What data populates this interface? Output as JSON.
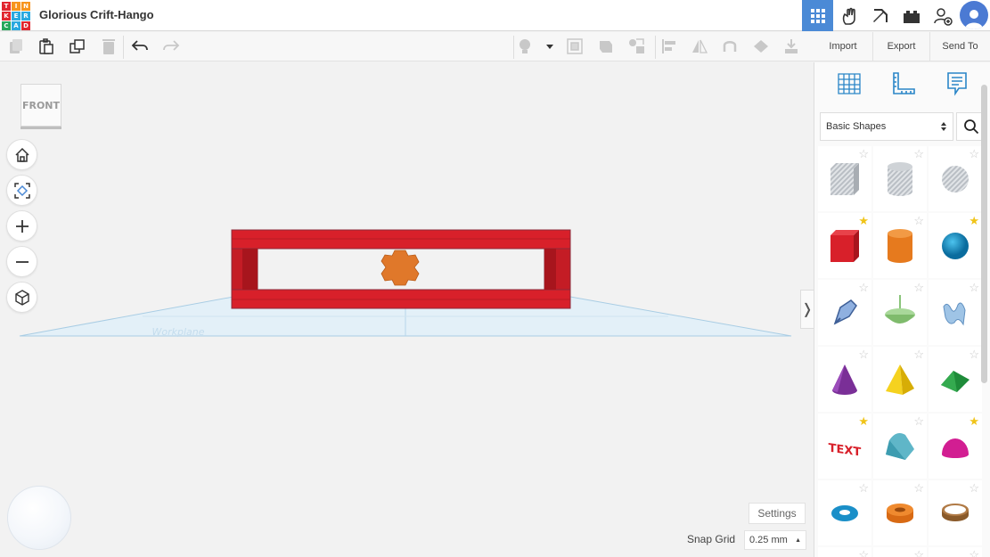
{
  "app": {
    "logo_letters": [
      "T",
      "I",
      "N",
      "K",
      "E",
      "R",
      "C",
      "A",
      "D"
    ],
    "logo_colors": [
      "#e1262f",
      "#f7941d",
      "#f7941d",
      "#e1262f",
      "#2aa9e0",
      "#2aa9e0",
      "#26a85b",
      "#2aa9e0",
      "#e1262f"
    ],
    "title": "Glorious Crift-Hango"
  },
  "topbar": {
    "icons": [
      {
        "name": "grid-view-icon",
        "active": true
      },
      {
        "name": "circuits-icon"
      },
      {
        "name": "minecraft-pickaxe-icon"
      },
      {
        "name": "bricks-icon"
      },
      {
        "name": "add-user-icon"
      },
      {
        "name": "profile-avatar-icon"
      }
    ]
  },
  "toolbar": {
    "icons": [
      "copy-icon",
      "paste-icon",
      "duplicate-icon",
      "delete-icon",
      "undo-icon",
      "redo-icon",
      "light-bulb-icon",
      "dropdown-caret-icon",
      "note-icon",
      "shape-hole-icon",
      "group-icon",
      "ungroup-icon",
      "align-icon",
      "mirror-icon",
      "magnet-icon",
      "flip-icon",
      "cruise-icon"
    ]
  },
  "actions": {
    "import": "Import",
    "export": "Export",
    "send_to": "Send To"
  },
  "viewcube": {
    "label": "FRONT"
  },
  "nav": [
    "home-icon",
    "fit-view-icon",
    "zoom-in-icon",
    "zoom-out-icon",
    "perspective-cube-icon"
  ],
  "workplane": {
    "label": "Workplane"
  },
  "settings": {
    "label": "Settings"
  },
  "snap_grid": {
    "label": "Snap Grid",
    "value": "0.25 mm"
  },
  "panel": {
    "modes": [
      "workplane-grid-icon",
      "ruler-icon",
      "notes-icon"
    ],
    "shape_library": "Basic Shapes",
    "shapes": [
      {
        "name": "box-hole-shape",
        "fav": false
      },
      {
        "name": "cylinder-hole-shape",
        "fav": false
      },
      {
        "name": "sphere-hole-shape",
        "fav": false
      },
      {
        "name": "box-shape",
        "fav": true
      },
      {
        "name": "cylinder-shape",
        "fav": false
      },
      {
        "name": "sphere-shape",
        "fav": true
      },
      {
        "name": "scribble-shape",
        "fav": false
      },
      {
        "name": "spinner-shape",
        "fav": false
      },
      {
        "name": "text-sketch-shape",
        "fav": false
      },
      {
        "name": "cone-shape",
        "fav": false
      },
      {
        "name": "pyramid-shape",
        "fav": false
      },
      {
        "name": "roof-shape",
        "fav": false
      },
      {
        "name": "text-shape",
        "fav": true,
        "text": "TEXT"
      },
      {
        "name": "round-roof-shape",
        "fav": false
      },
      {
        "name": "half-sphere-shape",
        "fav": true
      },
      {
        "name": "torus-shape",
        "fav": false
      },
      {
        "name": "tube-shape",
        "fav": false
      },
      {
        "name": "ring-shape",
        "fav": false
      }
    ]
  }
}
